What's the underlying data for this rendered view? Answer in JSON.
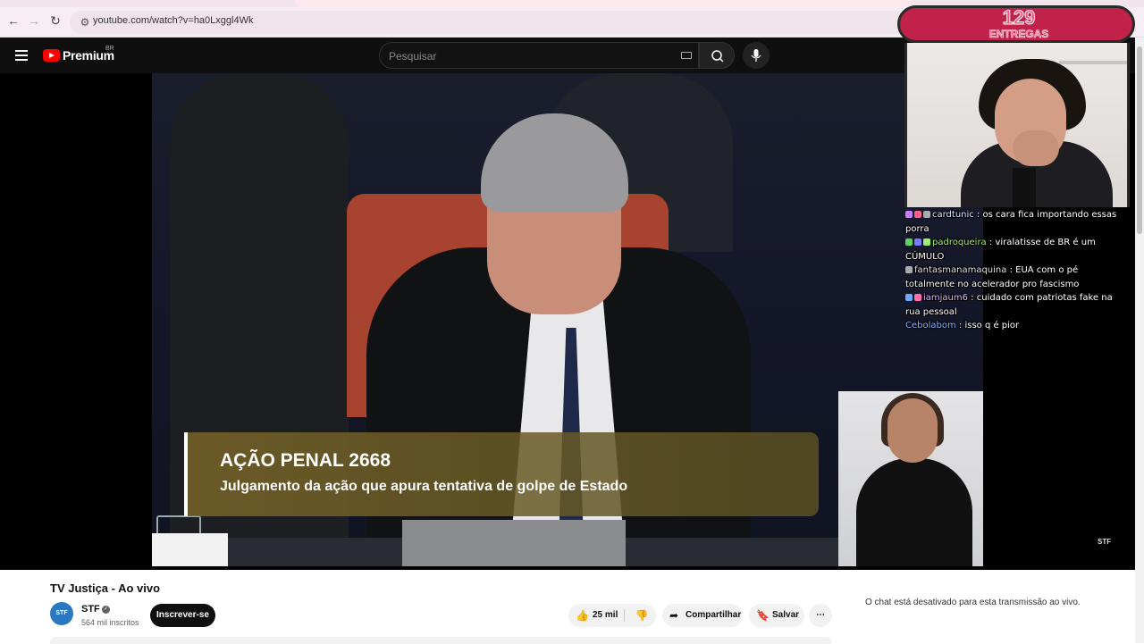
{
  "browser": {
    "url": "youtube.com/watch?v=ha0Lxggl4Wk"
  },
  "header": {
    "logo_text": "Premium",
    "logo_country": "BR",
    "search_placeholder": "Pesquisar"
  },
  "video": {
    "lower_third_title": "AÇÃO PENAL 2668",
    "lower_third_subtitle": "Julgamento da ação que apura tentativa de golpe de Estado",
    "watermark": "STF"
  },
  "overlay": {
    "counter_number": "129",
    "counter_label": "ENTREGAS",
    "chat": [
      {
        "user": "cardtunic",
        "user_color": "#cfe8ff",
        "message": "os cara fica importando essas porra",
        "badges": [
          "#c77dff",
          "#ff5f8a",
          "#aaaaaa"
        ]
      },
      {
        "user": "padroqueira",
        "user_color": "#9ef06a",
        "message": "viralatisse de BR é um CÚMULO",
        "badges": [
          "#5fd35f",
          "#7a7aff",
          "#9ef06a"
        ]
      },
      {
        "user": "fantasmanamaquina",
        "user_color": "#e0e0e0",
        "message": "EUA com o pé totalmente no acelerador pro fascismo",
        "badges": [
          "#aaaaaa"
        ]
      },
      {
        "user": "iamjaum6",
        "user_color": "#d8b4ff",
        "message": "cuidado com patriotas fake na rua pessoal",
        "badges": [
          "#6fa8ff",
          "#ff6fa8"
        ]
      },
      {
        "user": "Cebolabom",
        "user_color": "#7fb6ff",
        "message": "isso q é pior",
        "badges": []
      }
    ]
  },
  "info": {
    "title": "TV Justiça - Ao vivo",
    "channel_name": "STF",
    "channel_avatar_text": "STF",
    "subscribers": "564 mil inscritos",
    "subscribe_label": "Inscrever-se",
    "like_count": "25 mil",
    "share_label": "Compartilhar",
    "save_label": "Salvar",
    "chat_disabled": "O chat está desativado para esta transmissão ao vivo."
  },
  "colors": {
    "youtube_red": "#ff0000",
    "header_bg": "#0f0f0f",
    "counter_pink": "#c0224a"
  }
}
